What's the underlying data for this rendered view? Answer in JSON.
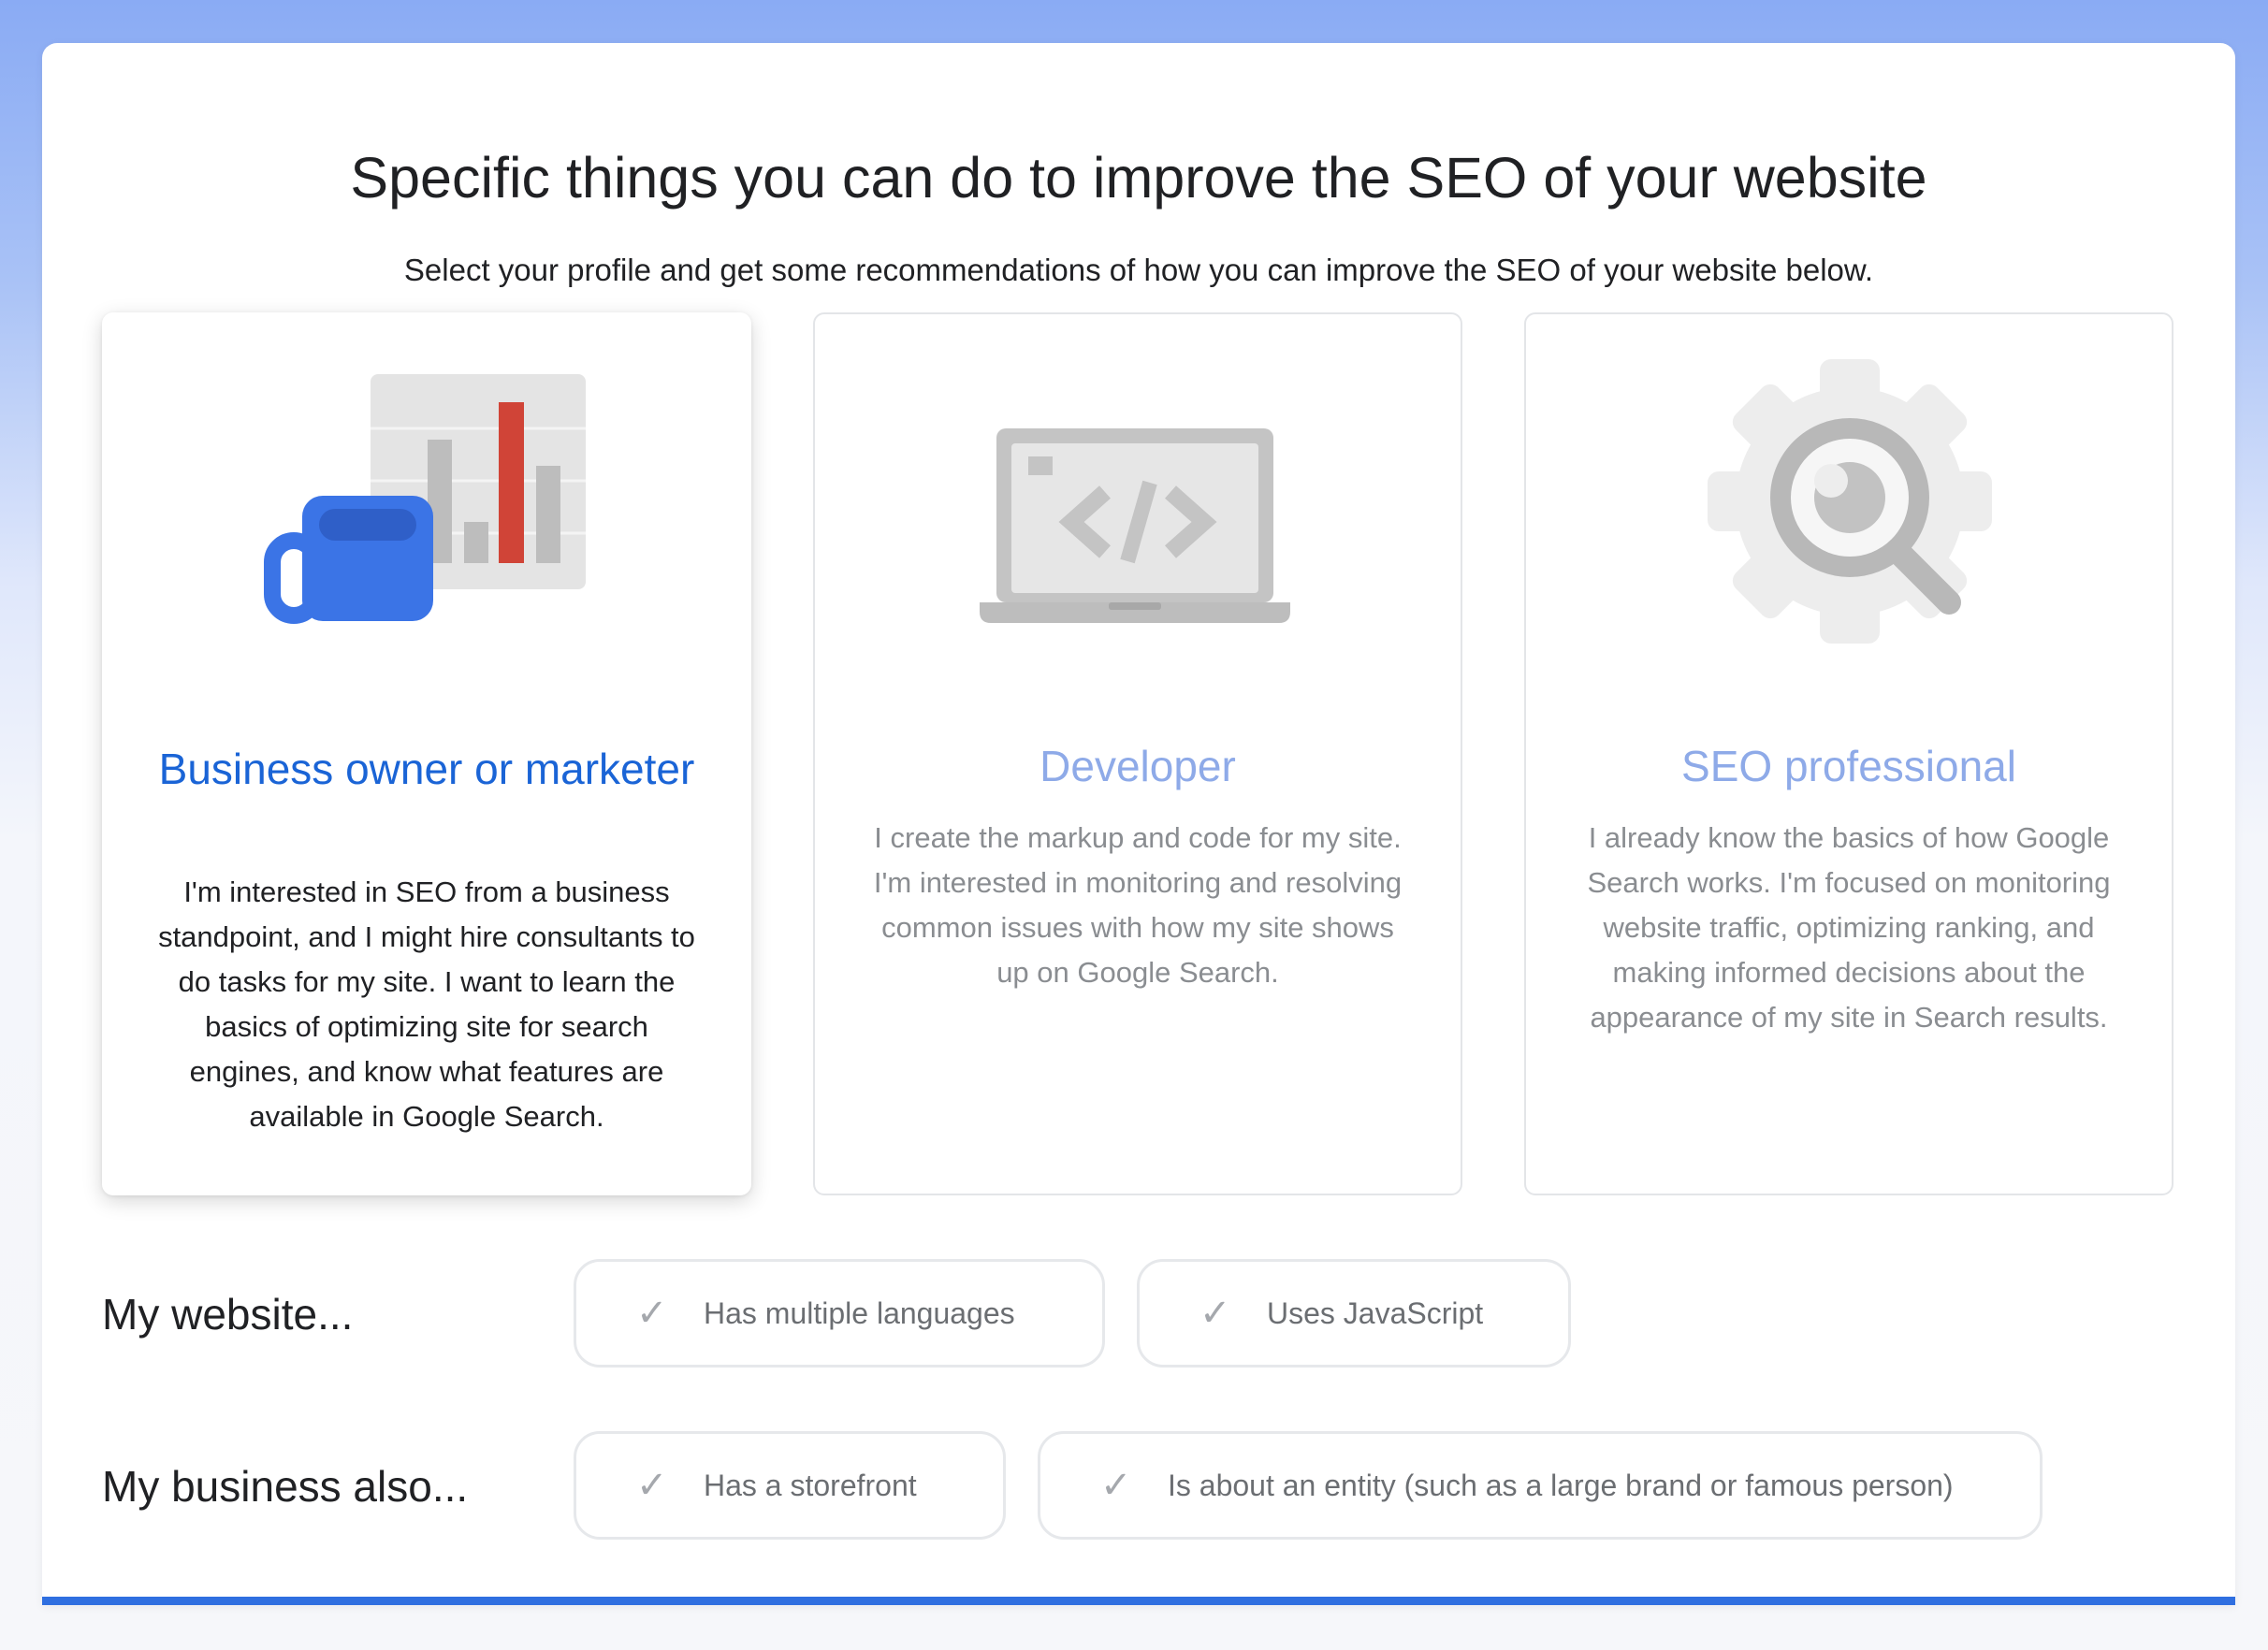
{
  "header": {
    "title": "Specific things you can do to improve the SEO of your website",
    "subtitle": "Select your profile and get some recommendations of how you can improve the SEO of your website below."
  },
  "profiles": [
    {
      "title": "Business owner or marketer",
      "description": "I'm interested in SEO from a business standpoint, and I might hire consultants to do tasks for my site. I want to learn the basics of optimizing site for search engines, and know what features are available in Google Search.",
      "icon": "mug-and-bar-chart-icon",
      "selected": true
    },
    {
      "title": "Developer",
      "description": "I create the markup and code for my site. I'm interested in monitoring and resolving common issues with how my site shows up on Google Search.",
      "icon": "laptop-code-icon",
      "selected": false
    },
    {
      "title": "SEO professional",
      "description": "I already know the basics of how Google Search works. I'm focused on monitoring website traffic, optimizing ranking, and making informed decisions about the appearance of my site in Search results.",
      "icon": "gear-magnifier-icon",
      "selected": false
    }
  ],
  "website_filters": {
    "label": "My website...",
    "options": [
      "Has multiple languages",
      "Uses JavaScript"
    ]
  },
  "business_filters": {
    "label": "My business also...",
    "options": [
      "Has a storefront",
      "Is about an entity (such as a large brand or famous person)"
    ]
  },
  "check_glyph": "✓",
  "colors": {
    "accent": "#1a64d6",
    "accent_inactive": "#8eaae8",
    "chart_red": "#d04437",
    "mug_blue": "#3b74e6",
    "bar": "#2f6fe0"
  }
}
